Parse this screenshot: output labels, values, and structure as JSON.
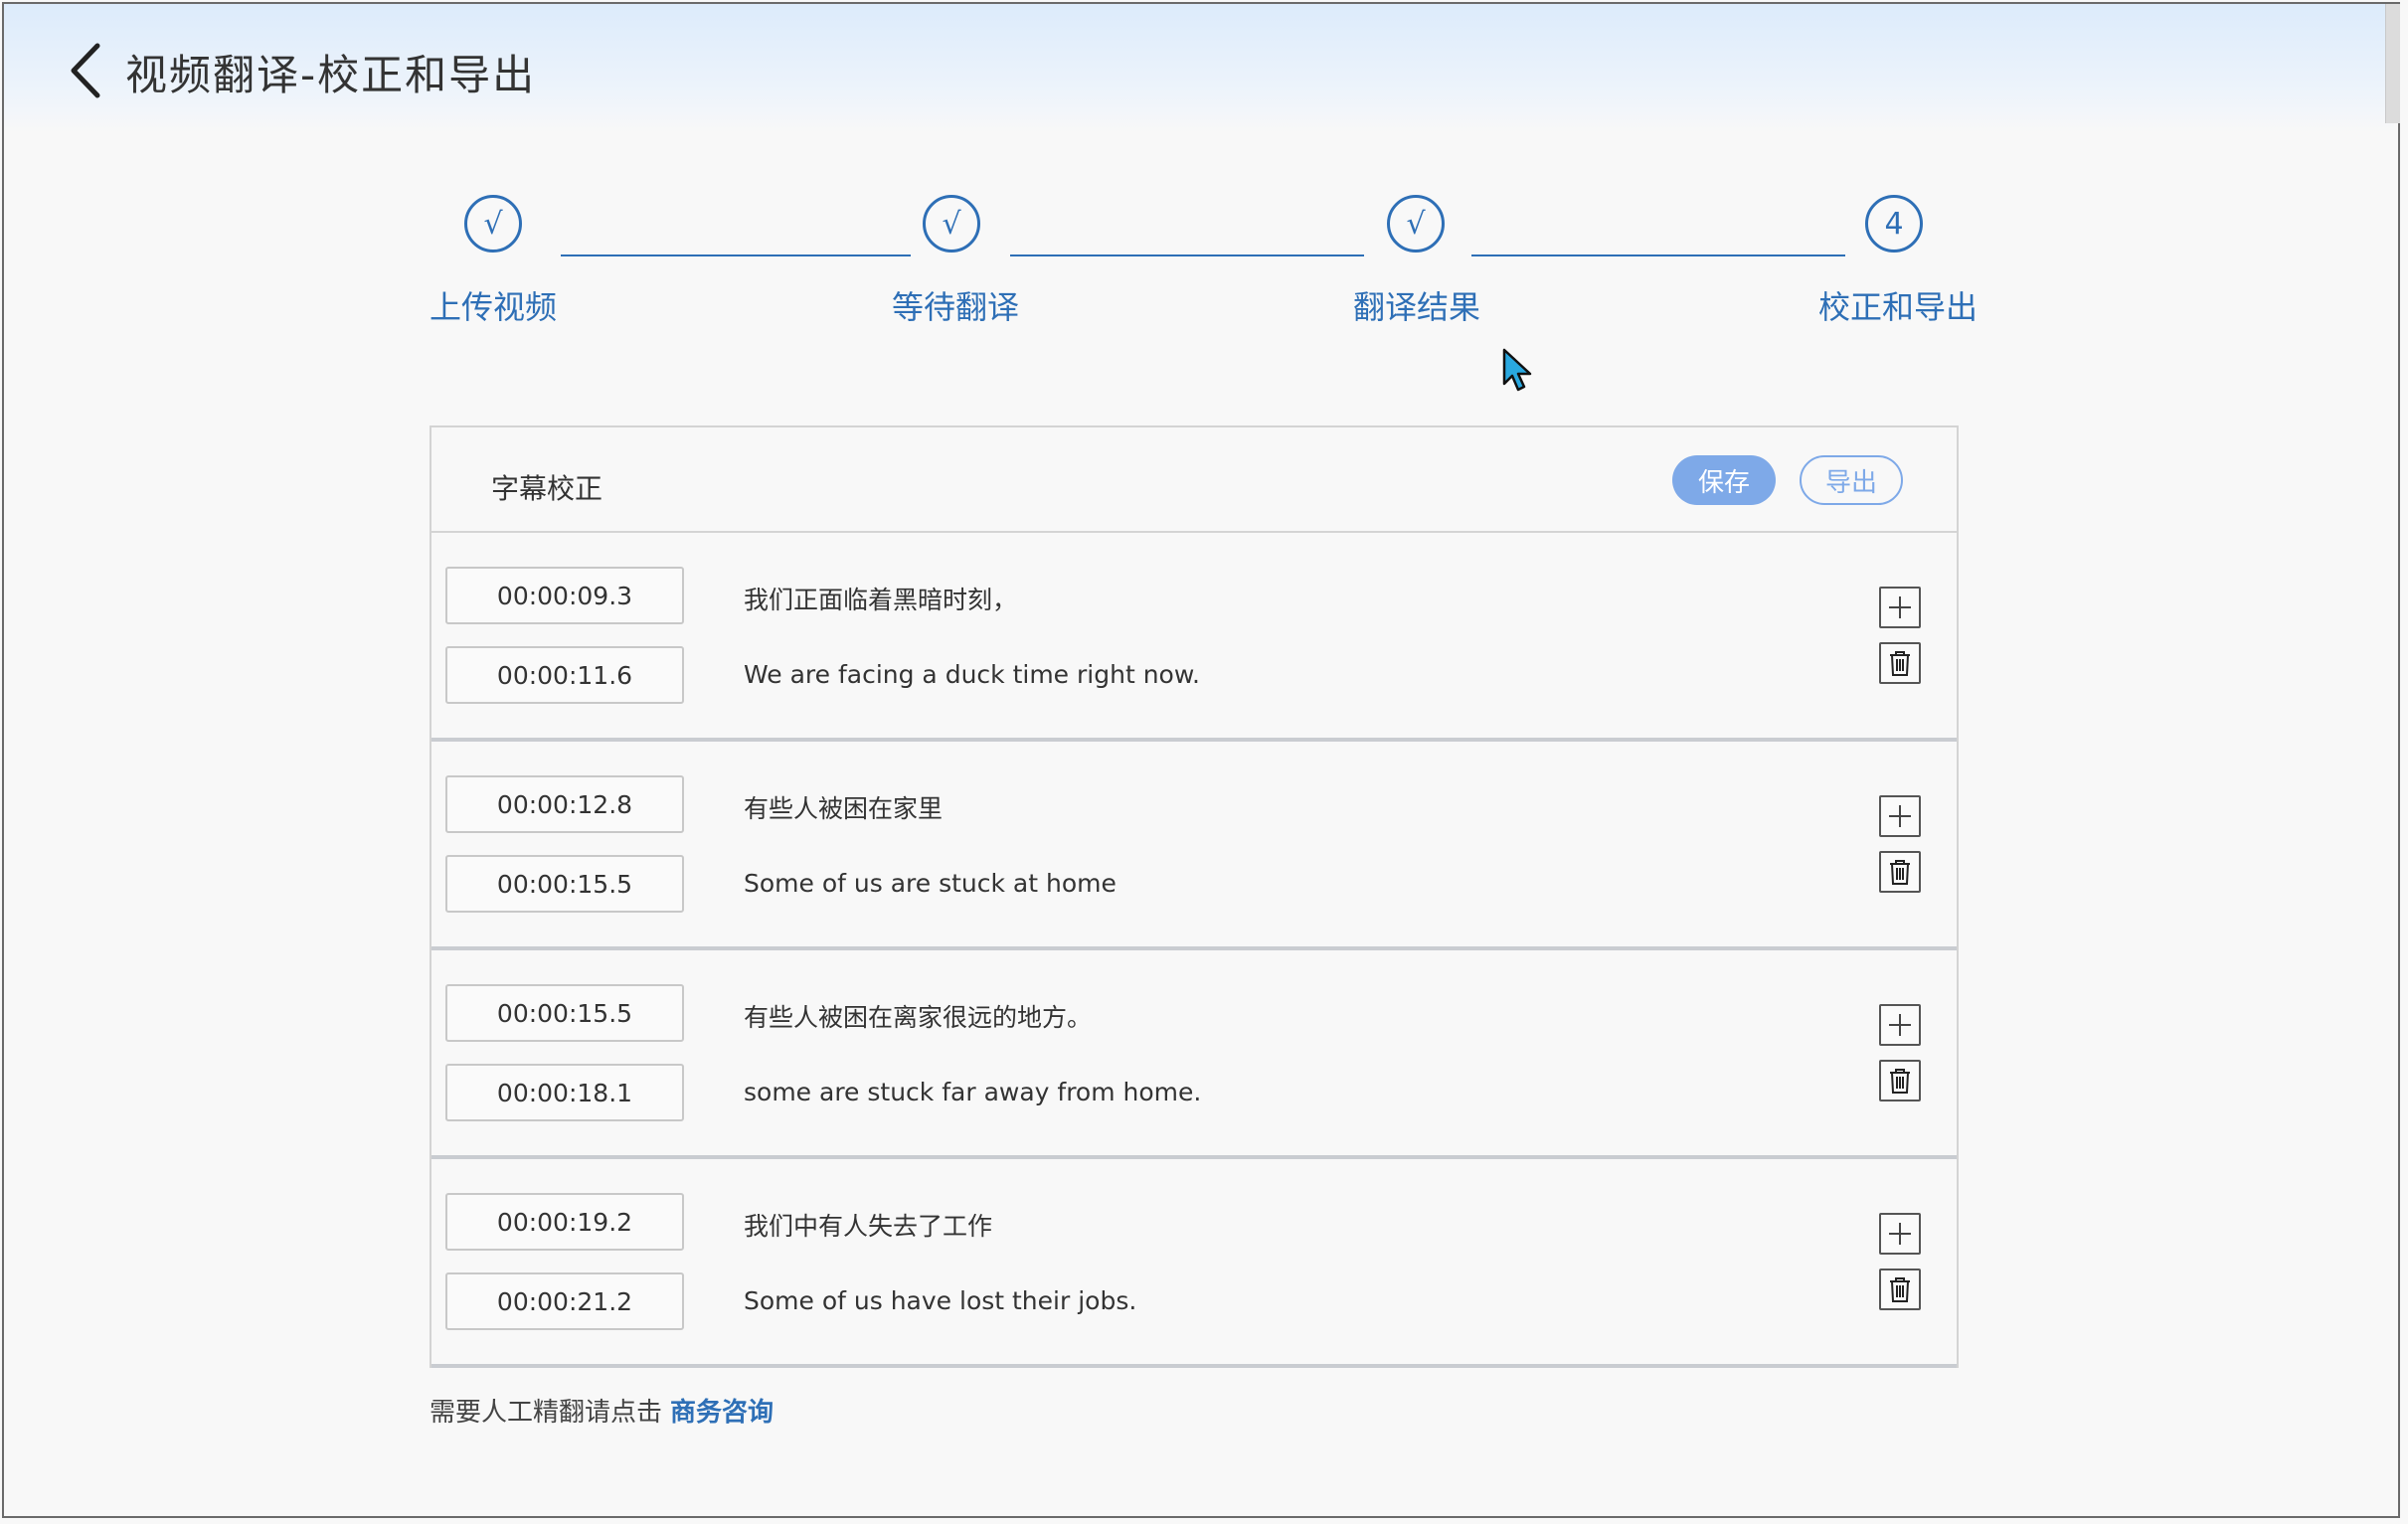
{
  "header": {
    "title": "视频翻译-校正和导出"
  },
  "steps": [
    {
      "mark": "√",
      "label": "上传视频"
    },
    {
      "mark": "√",
      "label": "等待翻译"
    },
    {
      "mark": "√",
      "label": "翻译结果"
    },
    {
      "mark": "4",
      "label": "校正和导出"
    }
  ],
  "panel": {
    "title": "字幕校正",
    "save_label": "保存",
    "export_label": "导出"
  },
  "subtitles": [
    {
      "start": "00:00:09.3",
      "end": "00:00:11.6",
      "zh": "我们正面临着黑暗时刻，",
      "en": "We are facing a duck time right now."
    },
    {
      "start": "00:00:12.8",
      "end": "00:00:15.5",
      "zh": "有些人被困在家里",
      "en": "Some of us are stuck at home"
    },
    {
      "start": "00:00:15.5",
      "end": "00:00:18.1",
      "zh": "有些人被困在离家很远的地方。",
      "en": "some are stuck far away from home."
    },
    {
      "start": "00:00:19.2",
      "end": "00:00:21.2",
      "zh": "我们中有人失去了工作",
      "en": "Some of us have lost their jobs."
    }
  ],
  "footer": {
    "note": "需要人工精翻请点击",
    "link": "商务咨询"
  },
  "colors": {
    "accent": "#2e6fb6",
    "save_button": "#7ea9e8",
    "header_gradient_top": "#dcebfb"
  }
}
